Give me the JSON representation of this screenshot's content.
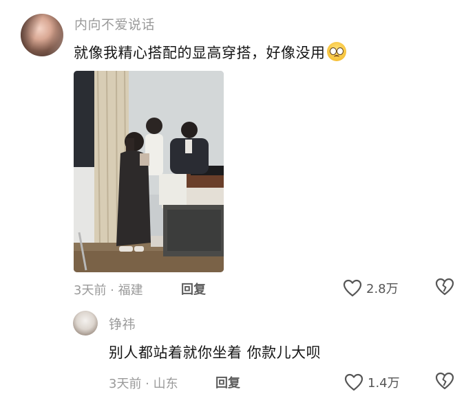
{
  "comment": {
    "username": "内向不爱说话",
    "text": "就像我精心搭配的显高穿搭，好像没用",
    "emoji_icon": "pleading-face-emoji",
    "meta": "3天前 · 福建",
    "reply_label": "回复",
    "likes": "2.8万"
  },
  "reply": {
    "username": "铮祎",
    "text": "别人都站着就你坐着 你款儿大呗",
    "meta": "3天前 · 山东",
    "reply_label": "回复",
    "likes": "1.4万"
  },
  "icons": {
    "like": "heart-outline-icon",
    "dislike": "broken-heart-icon"
  },
  "colors": {
    "text_primary": "#161616",
    "text_secondary": "#9a9a9a",
    "icon": "#555555"
  }
}
